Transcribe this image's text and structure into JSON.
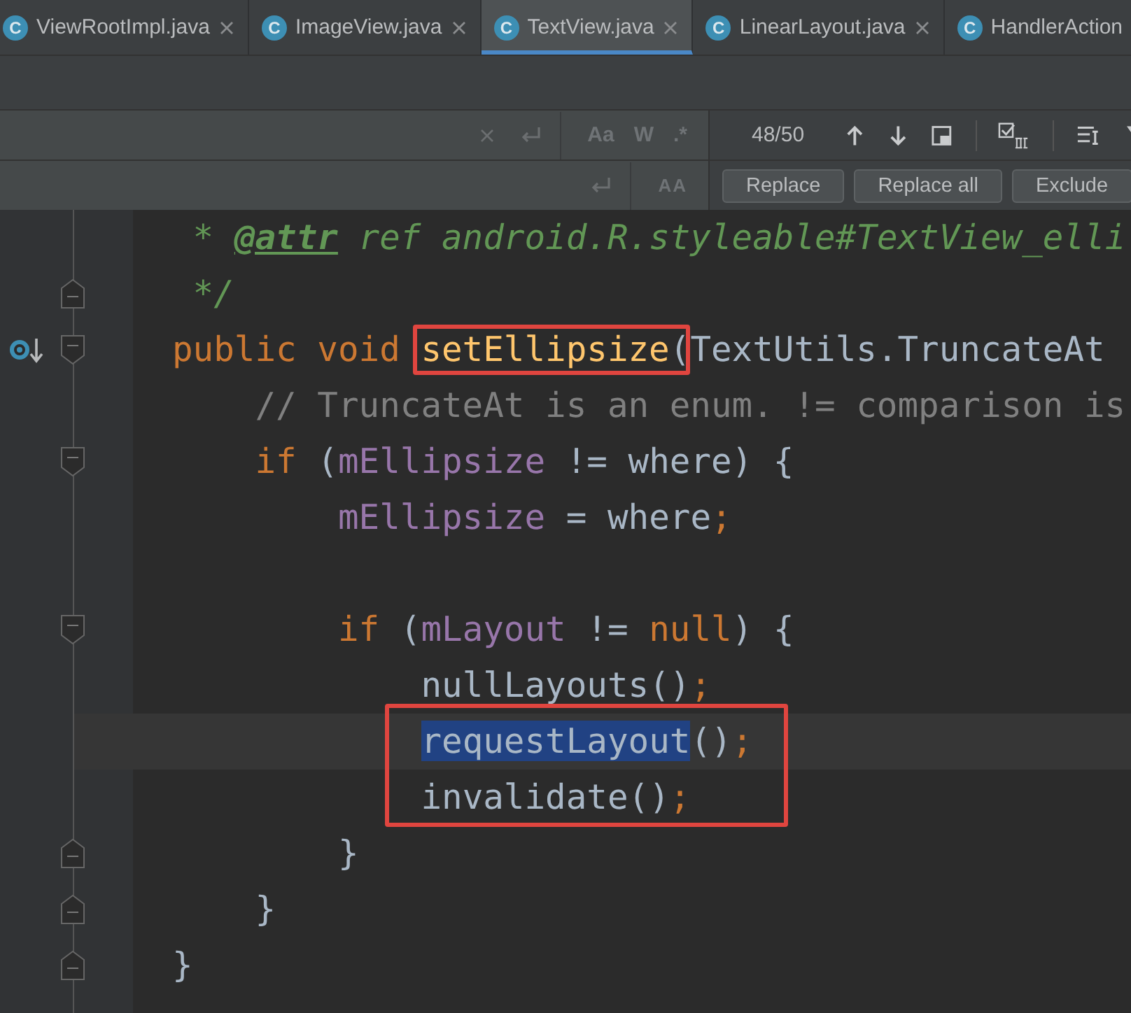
{
  "tabs": [
    {
      "icon_letter": "C",
      "label": "ViewRootImpl.java",
      "selected": false
    },
    {
      "icon_letter": "C",
      "label": "ImageView.java",
      "selected": false
    },
    {
      "icon_letter": "C",
      "label": "TextView.java",
      "selected": true
    },
    {
      "icon_letter": "C",
      "label": "LinearLayout.java",
      "selected": false
    },
    {
      "icon_letter": "C",
      "label": "HandlerAction",
      "selected": false
    }
  ],
  "find": {
    "options": [
      "Aa",
      "W",
      ".*"
    ],
    "match_count": "48/50"
  },
  "replace": {
    "preserve_case": "AA",
    "buttons": [
      "Replace",
      "Replace all",
      "Exclude"
    ]
  },
  "code": [
    {
      "tokens": [
        {
          "text": " * ",
          "kind": "doc"
        },
        {
          "text": "@attr",
          "kind": "doctag"
        },
        {
          "text": " ref android.R.styleable#TextView_elli",
          "kind": "doc"
        }
      ]
    },
    {
      "fold_end": true,
      "tokens": [
        {
          "text": " */",
          "kind": "doc"
        }
      ]
    },
    {
      "fold_start": true,
      "override_marker": true,
      "tokens": [
        {
          "text": "public void ",
          "kind": "keyword"
        },
        {
          "text": "setEllipsize",
          "kind": "method",
          "boxed": true
        },
        {
          "text": "(",
          "kind": "plain",
          "boxed": true
        },
        {
          "text": "TextUtils.TruncateAt",
          "kind": "plain"
        }
      ]
    },
    {
      "tokens": [
        {
          "text": "// TruncateAt is an enum. != comparison is",
          "kind": "comment"
        }
      ]
    },
    {
      "fold_start": true,
      "tokens": [
        {
          "text": "if ",
          "kind": "keyword"
        },
        {
          "text": "(",
          "kind": "plain"
        },
        {
          "text": "mEllipsize",
          "kind": "field"
        },
        {
          "text": " != where) {",
          "kind": "plain"
        }
      ]
    },
    {
      "tokens": [
        {
          "text": "mEllipsize",
          "kind": "field"
        },
        {
          "text": " = where",
          "kind": "plain"
        },
        {
          "text": ";",
          "kind": "keyword"
        }
      ]
    },
    {
      "blank_line_before": true,
      "fold_start": true,
      "tokens": [
        {
          "text": "if ",
          "kind": "keyword"
        },
        {
          "text": "(",
          "kind": "plain"
        },
        {
          "text": "mLayout",
          "kind": "field"
        },
        {
          "text": " != ",
          "kind": "plain"
        },
        {
          "text": "null",
          "kind": "keyword"
        },
        {
          "text": ") {",
          "kind": "plain"
        }
      ]
    },
    {
      "tokens": [
        {
          "text": "nullLayouts()",
          "kind": "plain"
        },
        {
          "text": ";",
          "kind": "keyword"
        }
      ]
    },
    {
      "current": true,
      "boxed": true,
      "tokens": [
        {
          "text": "requestLayout",
          "kind": "plain",
          "selected": true
        },
        {
          "text": "()",
          "kind": "plain"
        },
        {
          "text": ";",
          "kind": "keyword"
        }
      ]
    },
    {
      "boxed": true,
      "tokens": [
        {
          "text": "invalidate()",
          "kind": "plain"
        },
        {
          "text": ";",
          "kind": "keyword"
        }
      ]
    },
    {
      "fold_end": true,
      "tokens": [
        {
          "text": "}",
          "kind": "plain"
        }
      ]
    },
    {
      "fold_end": true,
      "tokens": [
        {
          "text": "}",
          "kind": "plain"
        }
      ]
    },
    {
      "fold_end": true,
      "tokens": [
        {
          "text": "}",
          "kind": "plain"
        }
      ]
    }
  ]
}
